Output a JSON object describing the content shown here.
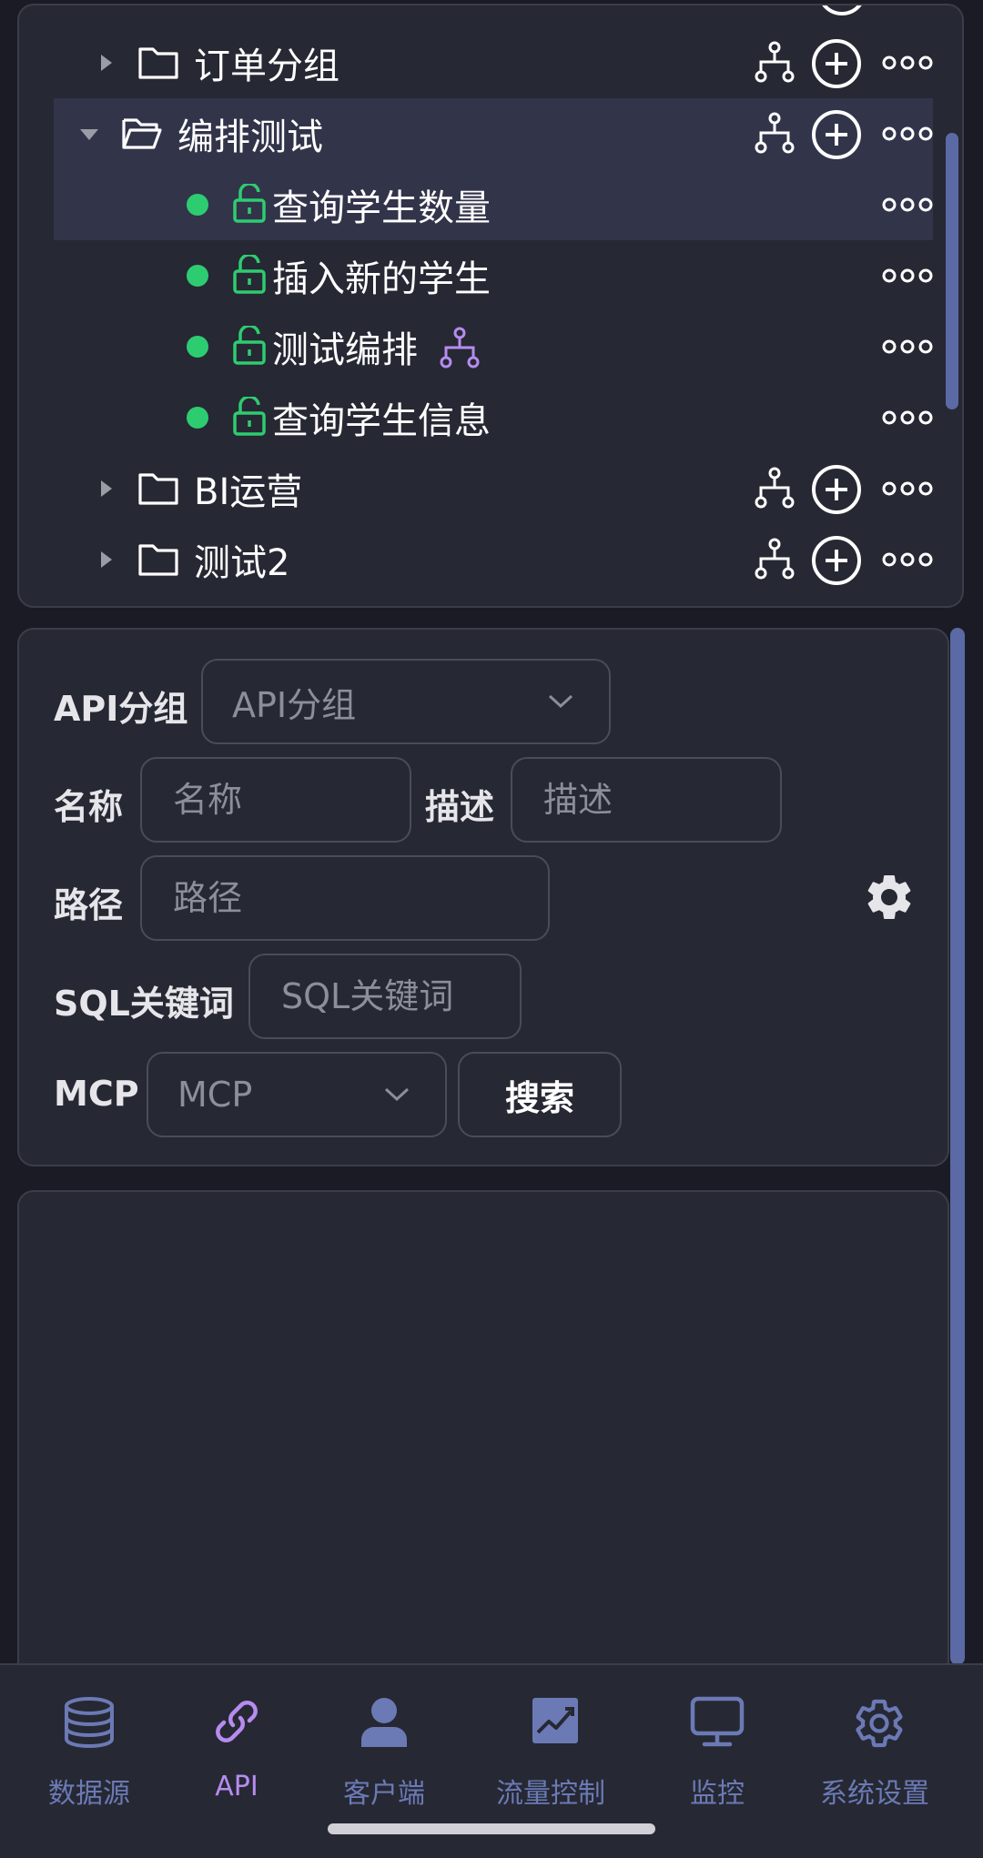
{
  "tree": {
    "groups": [
      {
        "label": "订单分组",
        "expanded": false
      },
      {
        "label": "编排测试",
        "expanded": true
      },
      {
        "label": "BI运营",
        "expanded": false
      },
      {
        "label": "测试2",
        "expanded": false
      }
    ],
    "apis": [
      {
        "label": "查询学生数量"
      },
      {
        "label": "插入新的学生"
      },
      {
        "label": "测试编排",
        "has_flow": true
      },
      {
        "label": "查询学生信息"
      }
    ]
  },
  "search": {
    "group_label": "API分组",
    "group_placeholder": "API分组",
    "name_label": "名称",
    "name_placeholder": "名称",
    "desc_label": "描述",
    "desc_placeholder": "描述",
    "path_label": "路径",
    "path_placeholder": "路径",
    "sql_label": "SQL关键词",
    "sql_placeholder": "SQL关键词",
    "mcp_label": "MCP",
    "mcp_placeholder": "MCP",
    "search_button": "搜索"
  },
  "nav": {
    "items": [
      {
        "label": "数据源",
        "icon": "database-icon"
      },
      {
        "label": "API",
        "icon": "link-icon",
        "active": true
      },
      {
        "label": "客户端",
        "icon": "user-icon"
      },
      {
        "label": "流量控制",
        "icon": "chart-icon"
      },
      {
        "label": "监控",
        "icon": "monitor-icon"
      },
      {
        "label": "系统设置",
        "icon": "gear-icon"
      }
    ]
  },
  "colors": {
    "background": "#1a1b24",
    "panel": "#262833",
    "selected_row": "#32344a",
    "status_green": "#2ecc71",
    "nav_inactive": "#6b7ab5",
    "nav_active": "#b68cf0",
    "flow_purple": "#b68cf0"
  }
}
